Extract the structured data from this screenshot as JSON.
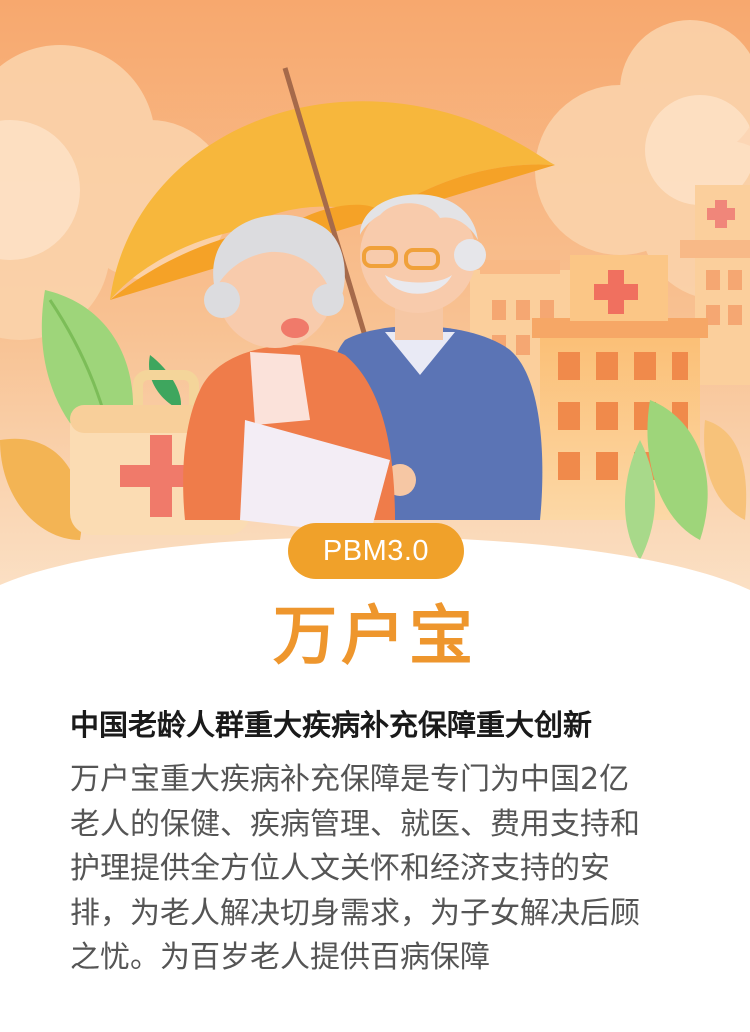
{
  "hero": {
    "illustration": "elderly-couple-under-umbrella",
    "icons": [
      "umbrella-icon",
      "medical-kit-icon",
      "hospital-building-icon",
      "leaf-icon",
      "cloud-icon"
    ],
    "colors": {
      "background": "#f6c08e",
      "umbrella": "#f7b53b",
      "cross": "#f07e6e",
      "accent": "#f0a12a"
    }
  },
  "badge": {
    "label": "PBM3.0"
  },
  "title": "万户宝",
  "subtitle": "中国老龄人群重大疾病补充保障重大创新",
  "description": {
    "lines": [
      "万户宝重大疾病补充保障是专门为中国2亿",
      "老人的保健、疾病管理、就医、费用支持和",
      "护理提供全方位人文关怀和经济支持的安",
      "排，为老人解决切身需求，为子女解决后顾",
      "之忧。为百岁老人提供百病保障"
    ]
  }
}
